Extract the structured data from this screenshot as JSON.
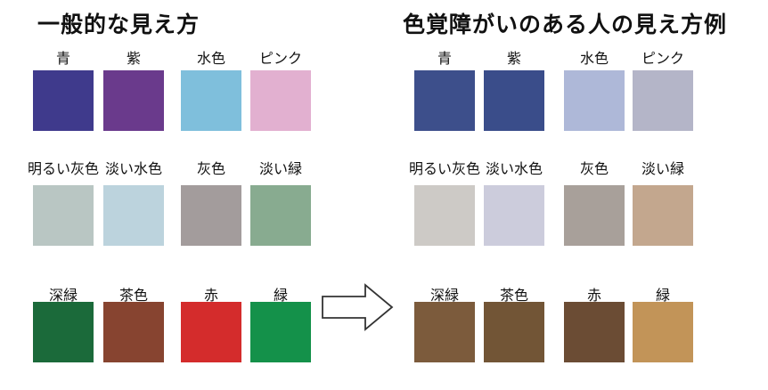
{
  "left": {
    "title": "一般的な見え方",
    "rows": [
      [
        {
          "label": "青",
          "color": "#3f3a8c"
        },
        {
          "label": "紫",
          "color": "#6a3a8c"
        },
        {
          "label": "水色",
          "color": "#7fbfdc"
        },
        {
          "label": "ピンク",
          "color": "#e2b0d0"
        }
      ],
      [
        {
          "label": "明るい灰色",
          "color": "#b9c6c3"
        },
        {
          "label": "淡い水色",
          "color": "#bcd3dd"
        },
        {
          "label": "灰色",
          "color": "#a39c9c"
        },
        {
          "label": "淡い緑",
          "color": "#88ab90"
        }
      ],
      [
        {
          "label": "深緑",
          "color": "#1b6a3a"
        },
        {
          "label": "茶色",
          "color": "#874430"
        },
        {
          "label": "赤",
          "color": "#d42c2c"
        },
        {
          "label": "緑",
          "color": "#14914a"
        }
      ]
    ]
  },
  "right": {
    "title": "色覚障がいのある人の見え方例",
    "rows": [
      [
        {
          "label": "青",
          "color": "#3d4f8b"
        },
        {
          "label": "紫",
          "color": "#3a4d8a"
        },
        {
          "label": "水色",
          "color": "#aeb8d8"
        },
        {
          "label": "ピンク",
          "color": "#b4b5c8"
        }
      ],
      [
        {
          "label": "明るい灰色",
          "color": "#cdcac6"
        },
        {
          "label": "淡い水色",
          "color": "#ccccdc"
        },
        {
          "label": "灰色",
          "color": "#a8a09a"
        },
        {
          "label": "淡い緑",
          "color": "#c3a78e"
        }
      ],
      [
        {
          "label": "深緑",
          "color": "#7c5b3c"
        },
        {
          "label": "茶色",
          "color": "#725536"
        },
        {
          "label": "赤",
          "color": "#6b4c34"
        },
        {
          "label": "緑",
          "color": "#c29458"
        }
      ]
    ]
  }
}
